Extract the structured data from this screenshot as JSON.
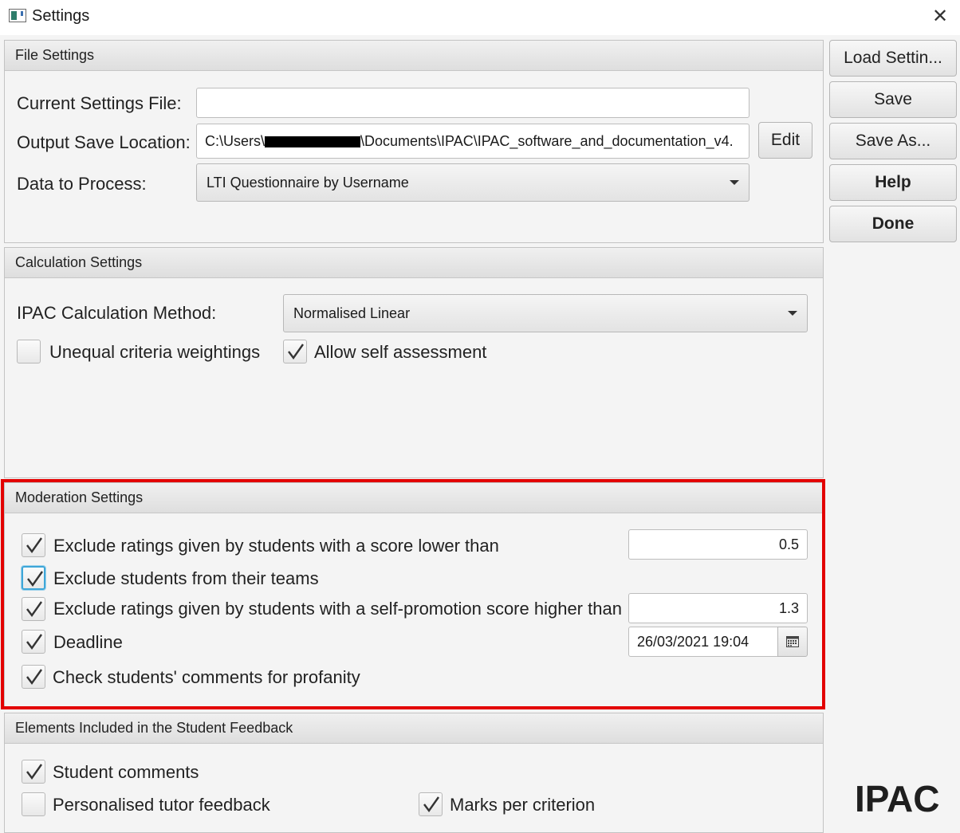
{
  "window": {
    "title": "Settings"
  },
  "sidebar": {
    "load_label": "Load Settin...",
    "save_label": "Save",
    "save_as_label": "Save As...",
    "help_label": "Help",
    "done_label": "Done"
  },
  "file_settings": {
    "header": "File Settings",
    "current_file_label": "Current Settings File:",
    "current_file_value": "",
    "output_label": "Output Save Location:",
    "output_value_prefix": "C:\\Users\\",
    "output_value_suffix": "\\Documents\\IPAC\\IPAC_software_and_documentation_v4.",
    "edit_label": "Edit",
    "data_label": "Data to Process:",
    "data_value": "LTI Questionnaire by Username"
  },
  "calculation_settings": {
    "header": "Calculation Settings",
    "method_label": "IPAC Calculation Method:",
    "method_value": "Normalised Linear",
    "unequal_label": "Unequal criteria weightings",
    "unequal_checked": false,
    "self_assess_label": "Allow self assessment",
    "self_assess_checked": true
  },
  "moderation_settings": {
    "header": "Moderation Settings",
    "exclude_low_label": "Exclude ratings given by students with a score lower than",
    "exclude_low_value": "0.5",
    "exclude_teams_label": "Exclude students from their teams",
    "exclude_self_promo_label": "Exclude ratings given by students with a self-promotion score higher than",
    "exclude_self_promo_value": "1.3",
    "deadline_label": "Deadline",
    "deadline_value": "26/03/2021 19:04",
    "profanity_label": "Check students' comments for profanity"
  },
  "feedback_elements": {
    "header": "Elements Included in the Student Feedback",
    "comments_label": "Student comments",
    "tutor_label": "Personalised tutor feedback",
    "marks_label": "Marks per criterion"
  },
  "branding": {
    "logo_text": "IPAC"
  },
  "colors": {
    "highlight": "#e30000",
    "focus": "#3ea6d8"
  },
  "icons": {
    "close": "close-icon",
    "check": "check-icon",
    "calendar": "calendar-icon",
    "dropdown": "chevron-down-icon"
  }
}
